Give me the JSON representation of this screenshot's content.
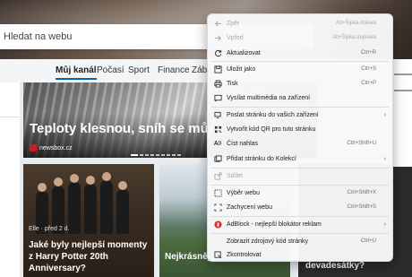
{
  "search": {
    "placeholder": "Hledat na webu"
  },
  "nav": {
    "items": [
      "Můj kanál",
      "Počasí",
      "Sport",
      "Finance",
      "Zába"
    ]
  },
  "featured": {
    "title": "Teploty klesnou, sníh se může v",
    "source": "newsbox.cz"
  },
  "cards": [
    {
      "meta": "Elle · před 2 d.",
      "title": "Jaké byly nejlepší momenty z Harry Potter 20th Anniversary?"
    },
    {
      "title": "Nejkrásnějš světa"
    },
    {
      "title": "devadesátky?"
    }
  ],
  "menu": {
    "items": [
      {
        "label": "Zpět",
        "shortcut": "Alt+Šipka doleva",
        "icon": "back-arrow-icon",
        "disabled": true
      },
      {
        "label": "Vpřed",
        "shortcut": "Alt+Šipka doprava",
        "icon": "forward-arrow-icon",
        "disabled": true
      },
      {
        "label": "Aktualizovat",
        "shortcut": "Ctrl+R",
        "icon": "refresh-icon"
      },
      {
        "label": "Uložit jako",
        "shortcut": "Ctrl+S",
        "icon": "save-icon"
      },
      {
        "label": "Tisk",
        "shortcut": "Ctrl+P",
        "icon": "print-icon"
      },
      {
        "label": "Vysílat multimédia na zařízení",
        "shortcut": "",
        "icon": "cast-icon"
      },
      {
        "label": "Poslat stránku do vašich zařízení",
        "shortcut": "",
        "icon": "send-to-device-icon",
        "submenu": true
      },
      {
        "label": "Vytvořit kód QR pro tuto stránku",
        "shortcut": "",
        "icon": "qr-code-icon"
      },
      {
        "label": "Číst nahlas",
        "shortcut": "Ctrl+Shift+U",
        "icon": "read-aloud-icon"
      },
      {
        "label": "Přidat stránku do Kolekcí",
        "shortcut": "",
        "icon": "collections-icon",
        "submenu": true
      },
      {
        "label": "Sdílet",
        "shortcut": "",
        "icon": "share-icon",
        "disabled": true
      },
      {
        "label": "Výběr webu",
        "shortcut": "Ctrl+Shift+X",
        "icon": "web-select-icon"
      },
      {
        "label": "Zachycení webu",
        "shortcut": "Ctrl+Shift+S",
        "icon": "web-capture-icon"
      },
      {
        "label": "AdBlock - nejlepší blokátor reklam",
        "shortcut": "",
        "icon": "adblock-icon",
        "submenu": true
      },
      {
        "label": "Zobrazit zdrojový kód stránky",
        "shortcut": "Ctrl+U",
        "icon": "view-source-icon"
      },
      {
        "label": "Zkontrolovat",
        "shortcut": "",
        "icon": "inspect-icon"
      }
    ]
  }
}
